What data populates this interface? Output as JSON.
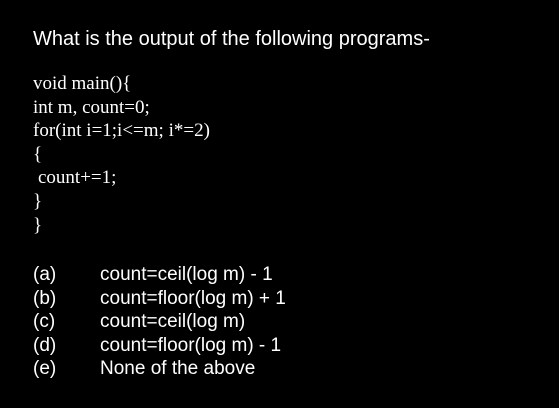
{
  "question": "What is the output of the following programs-",
  "code_lines": [
    "void main(){",
    "int m, count=0;",
    "for(int i=1;i<=m; i*=2)",
    "{",
    "count+=1;",
    "}",
    "}"
  ],
  "options": [
    {
      "letter": "(a)",
      "text": "count=ceil(log m) - 1"
    },
    {
      "letter": "(b)",
      "text": "count=floor(log m) + 1"
    },
    {
      "letter": "(c)",
      "text": "count=ceil(log m)"
    },
    {
      "letter": "(d)",
      "text": "count=floor(log m) - 1"
    },
    {
      "letter": "(e)",
      "text": "None of the above"
    }
  ]
}
